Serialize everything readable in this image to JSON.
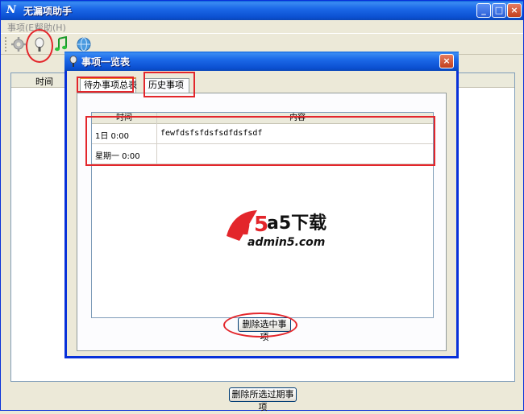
{
  "app": {
    "title": "无漏项助手",
    "icon_glyph": "N",
    "window_buttons": {
      "minimize": "_",
      "maximize": "□",
      "close": "×"
    }
  },
  "menu": {
    "items": [
      {
        "label": "事项(E)"
      },
      {
        "label": "帮助(H)"
      }
    ]
  },
  "toolbar": {
    "tools": [
      {
        "icon": "gear-icon"
      },
      {
        "icon": "magnifier-icon"
      },
      {
        "icon": "music-note-icon"
      },
      {
        "icon": "globe-icon"
      }
    ]
  },
  "main_list": {
    "columns": [
      "时间"
    ]
  },
  "main_actions": {
    "delete_expired_label": "删除所选过期事项"
  },
  "dialog": {
    "title": "事项一览表",
    "close_glyph": "×",
    "tabs": [
      {
        "label": "待办事项总表",
        "active": true
      },
      {
        "label": "历史事项",
        "active": false
      }
    ],
    "grid": {
      "columns": [
        "时间",
        "内容"
      ],
      "rows": [
        {
          "time": "1日 0:00",
          "content": "fewfdsfsfdsfsdfdsfsdf"
        },
        {
          "time": "星期一 0:00",
          "content": ""
        }
      ]
    },
    "watermark": {
      "logo_text": "a5下载",
      "domain": "admin5.com"
    },
    "delete_selected_label": "删除选中事项"
  },
  "colors": {
    "titlebar_blue": "#0b50d1",
    "annotation_red": "#e3262b",
    "window_bg": "#ece9d8"
  }
}
